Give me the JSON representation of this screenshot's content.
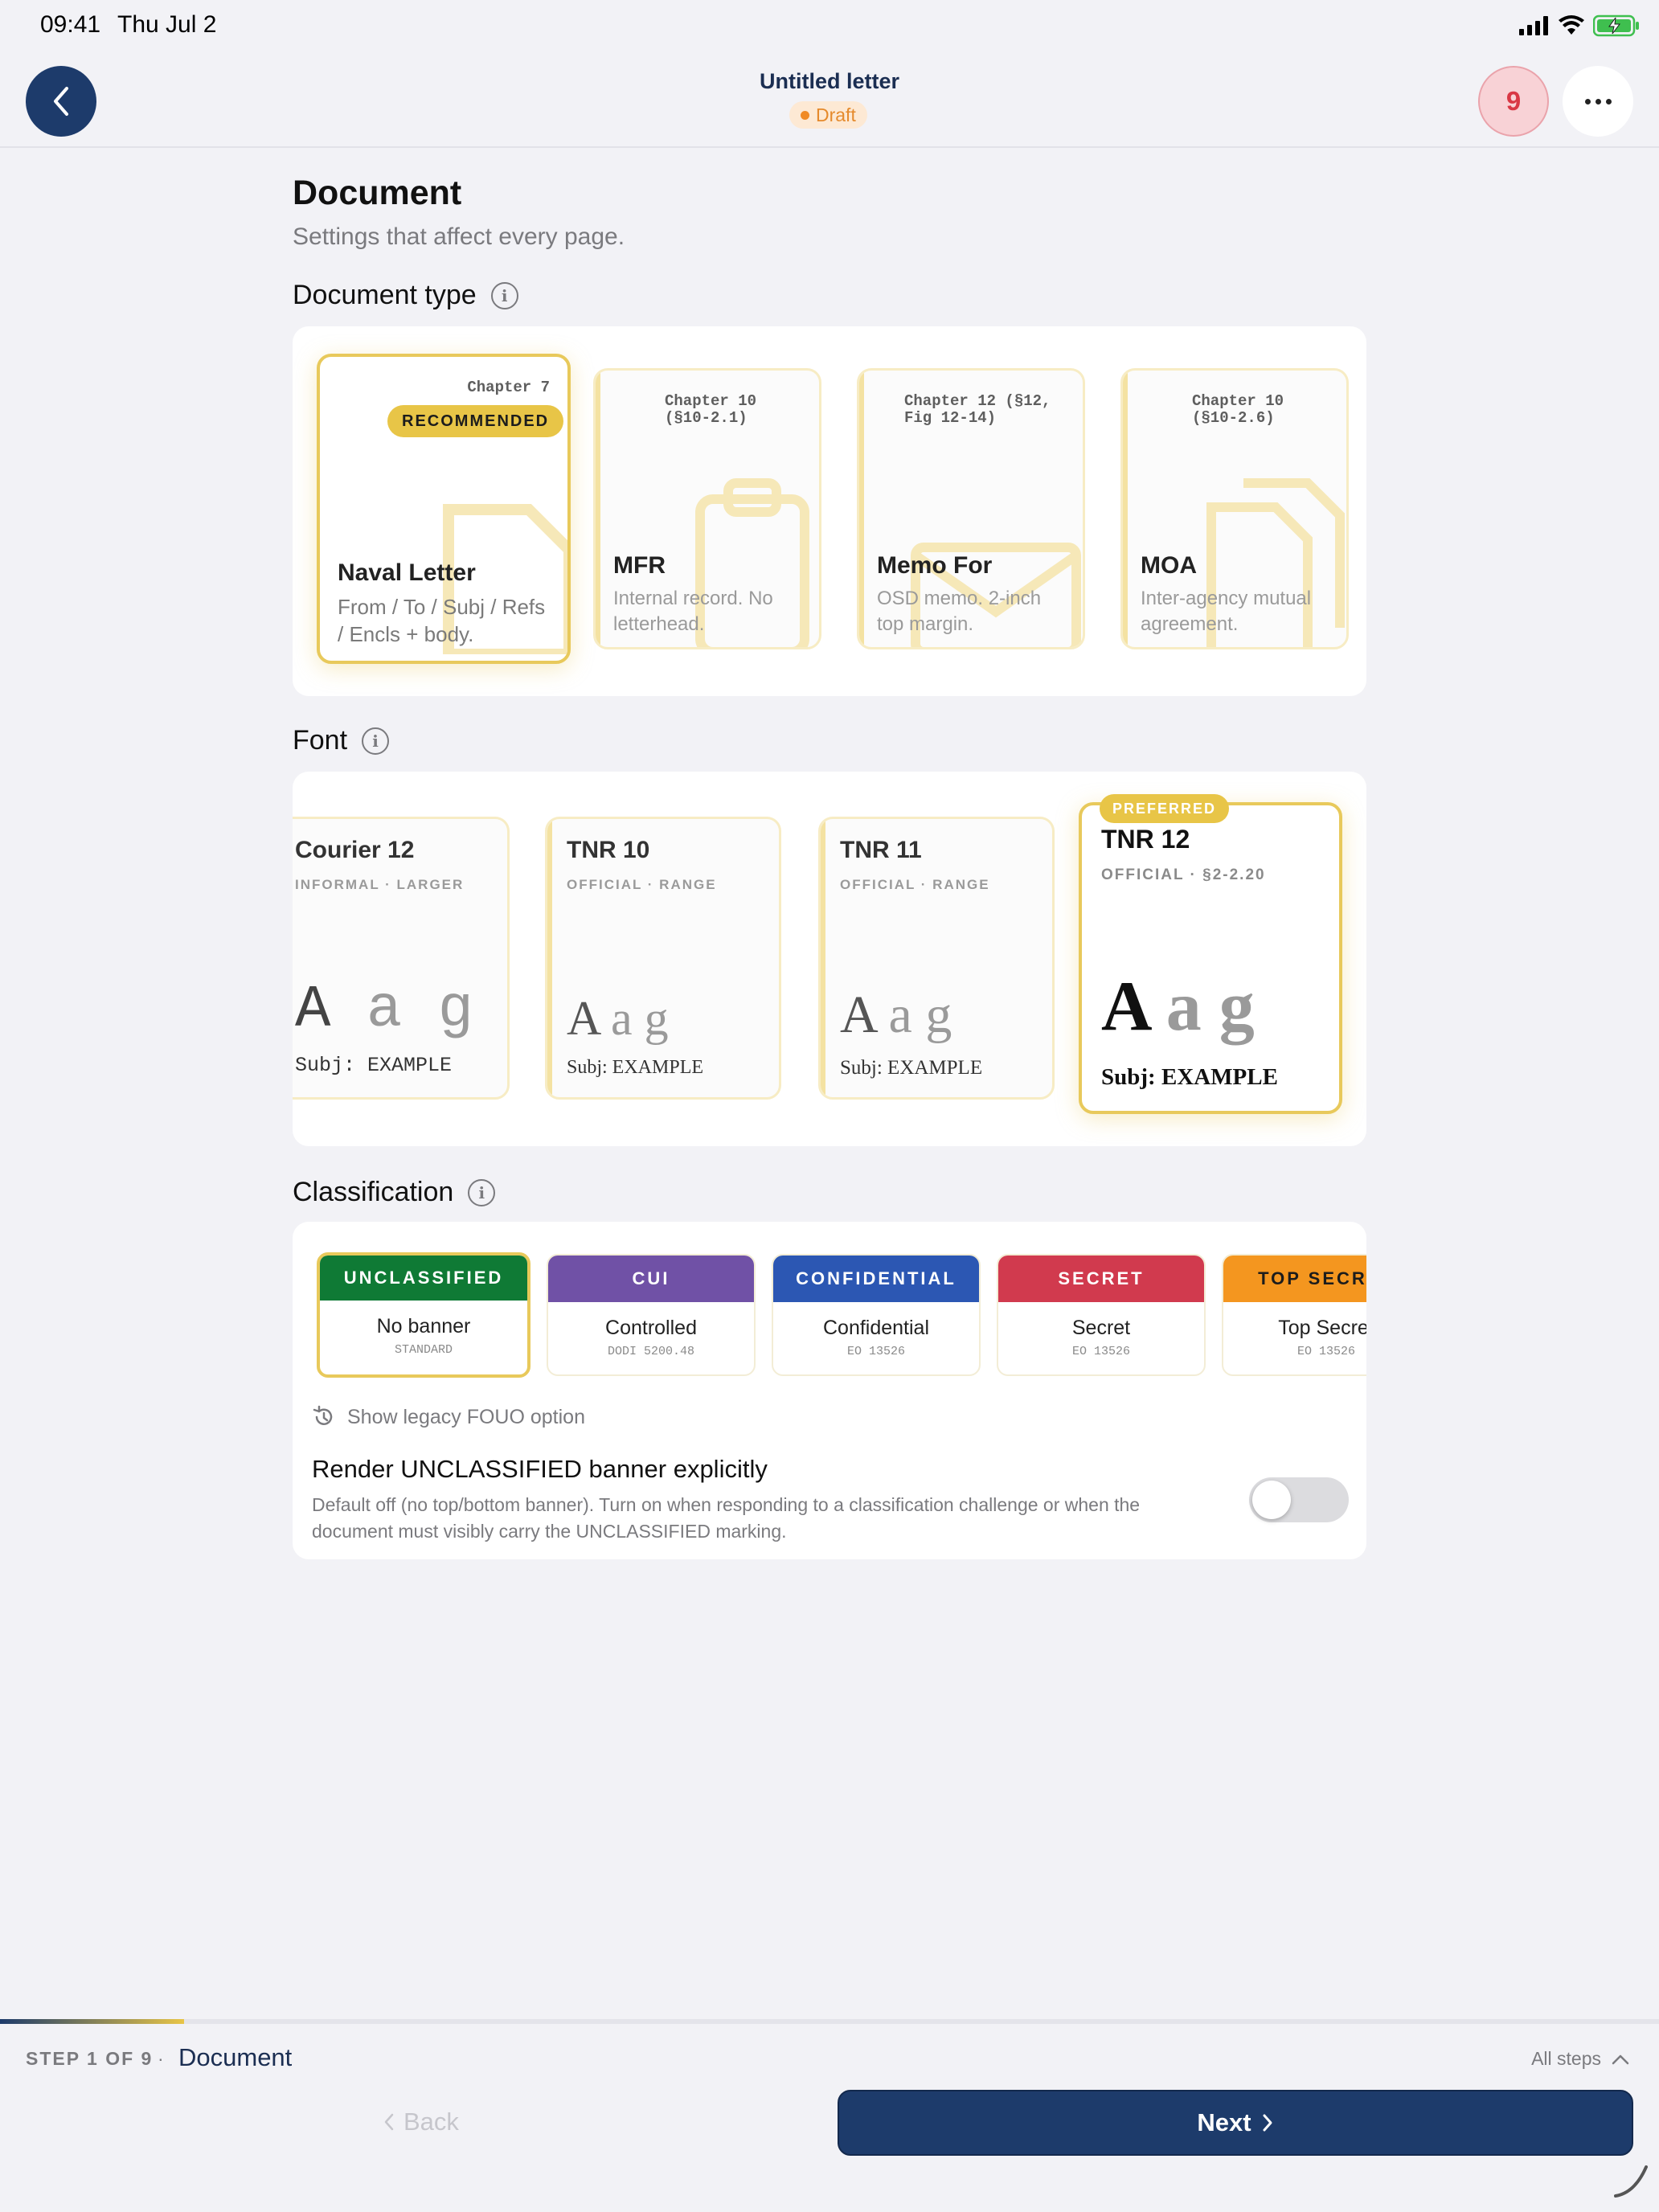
{
  "status_bar": {
    "time": "09:41",
    "date": "Thu Jul 2"
  },
  "header": {
    "title": "Untitled letter",
    "status": "Draft",
    "issues_count": "9"
  },
  "page": {
    "title": "Document",
    "subtitle": "Settings that affect every page."
  },
  "document_type": {
    "label": "Document type",
    "options": [
      {
        "chapter": "Chapter 7",
        "badge": "RECOMMENDED",
        "name": "Naval Letter",
        "description": "From / To / Subj / Refs / Encls + body.",
        "selected": true
      },
      {
        "chapter": "Chapter 10 (§10-2.1)",
        "name": "MFR",
        "description": "Internal record. No letterhead.",
        "selected": false
      },
      {
        "chapter": "Chapter 12 (§12, Fig 12-14)",
        "name": "Memo For",
        "description": "OSD memo. 2-inch top margin.",
        "selected": false
      },
      {
        "chapter": "Chapter 10 (§10-2.6)",
        "name": "MOA",
        "description": "Inter-agency mutual agreement.",
        "selected": false
      }
    ]
  },
  "font": {
    "label": "Font",
    "options": [
      {
        "name": "Courier 12",
        "meta": "INFORMAL · LARGER",
        "sample": "A a g",
        "subj": "Subj: EXAMPLE",
        "selected": false
      },
      {
        "name": "TNR 10",
        "meta": "OFFICIAL · RANGE",
        "sample": "A a g",
        "subj": "Subj: EXAMPLE",
        "selected": false
      },
      {
        "name": "TNR 11",
        "meta": "OFFICIAL · RANGE",
        "sample": "A a g",
        "subj": "Subj: EXAMPLE",
        "selected": false
      },
      {
        "name": "TNR 12",
        "meta": "OFFICIAL · §2-2.20",
        "badge": "PREFERRED",
        "sample": "A a g",
        "subj": "Subj: EXAMPLE",
        "selected": true
      }
    ]
  },
  "classification": {
    "label": "Classification",
    "options": [
      {
        "banner": "UNCLASSIFIED",
        "label": "No banner",
        "source": "STANDARD",
        "color": "#0f7a35",
        "selected": true
      },
      {
        "banner": "CUI",
        "label": "Controlled",
        "source": "DODI 5200.48",
        "color": "#7051a6",
        "selected": false
      },
      {
        "banner": "CONFIDENTIAL",
        "label": "Confidential",
        "source": "EO 13526",
        "color": "#2c57b3",
        "selected": false
      },
      {
        "banner": "SECRET",
        "label": "Secret",
        "source": "EO 13526",
        "color": "#d13a4e",
        "selected": false
      },
      {
        "banner": "TOP SECRET",
        "label": "Top Secret",
        "source": "EO 13526",
        "color": "#f4961f",
        "selected": false
      }
    ],
    "legacy_option": "Show legacy FOUO option",
    "render_explicit": {
      "title": "Render UNCLASSIFIED banner explicitly",
      "description": "Default off (no top/bottom banner). Turn on when responding to a classification challenge or when the document must visibly carry the UNCLASSIFIED marking.",
      "enabled": false
    }
  },
  "footer": {
    "step": "STEP 1 OF 9",
    "separator": "·",
    "step_name": "Document",
    "progress": 0.111,
    "all_steps": "All steps",
    "back_label": "Back",
    "next_label": "Next"
  }
}
